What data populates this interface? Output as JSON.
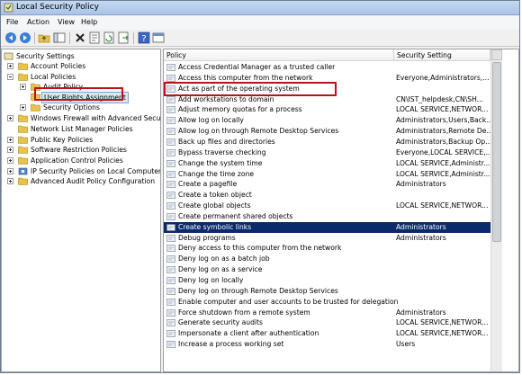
{
  "window": {
    "title": "Local Security Policy"
  },
  "menu": [
    {
      "label": "File"
    },
    {
      "label": "Action"
    },
    {
      "label": "View"
    },
    {
      "label": "Help"
    }
  ],
  "toolbar": {
    "buttons": [
      {
        "icon": "back-arrow-icon"
      },
      {
        "icon": "forward-arrow-icon"
      },
      {
        "icon": "up-folder-icon"
      },
      {
        "icon": "show-hide-tree-icon"
      },
      {
        "icon": "delete-icon"
      },
      {
        "icon": "properties-icon"
      },
      {
        "icon": "refresh-icon"
      },
      {
        "icon": "export-list-icon"
      },
      {
        "icon": "help-icon"
      },
      {
        "icon": "mmc-console-icon"
      }
    ]
  },
  "tree": {
    "items": [
      {
        "label": "Security Settings"
      },
      {
        "label": "Account Policies"
      },
      {
        "label": "Local Policies"
      },
      {
        "label": "Audit Policy"
      },
      {
        "label": "User Rights Assignment"
      },
      {
        "label": "Security Options"
      },
      {
        "label": "Windows Firewall with Advanced Security"
      },
      {
        "label": "Network List Manager Policies"
      },
      {
        "label": "Public Key Policies"
      },
      {
        "label": "Software Restriction Policies"
      },
      {
        "label": "Application Control Policies"
      },
      {
        "label": "IP Security Policies on Local Computer"
      },
      {
        "label": "Advanced Audit Policy Configuration"
      }
    ]
  },
  "list": {
    "columns": [
      {
        "label": "Policy"
      },
      {
        "label": "Security Setting"
      }
    ],
    "rows": [
      {
        "policy": "Access Credential Manager as a trusted caller",
        "setting": ""
      },
      {
        "policy": "Access this computer from the network",
        "setting": "Everyone,Administrators,..."
      },
      {
        "policy": "Act as part of the operating system",
        "setting": ""
      },
      {
        "policy": "Add workstations to domain",
        "setting": "CN\\IST_helpdesk,CN\\SH..."
      },
      {
        "policy": "Adjust memory quotas for a process",
        "setting": "LOCAL SERVICE,NETWOR..."
      },
      {
        "policy": "Allow log on locally",
        "setting": "Administrators,Users,Back..."
      },
      {
        "policy": "Allow log on through Remote Desktop Services",
        "setting": "Administrators,Remote De..."
      },
      {
        "policy": "Back up files and directories",
        "setting": "Administrators,Backup Op..."
      },
      {
        "policy": "Bypass traverse checking",
        "setting": "Everyone,LOCAL SERVICE,..."
      },
      {
        "policy": "Change the system time",
        "setting": "LOCAL SERVICE,Administr..."
      },
      {
        "policy": "Change the time zone",
        "setting": "LOCAL SERVICE,Administr..."
      },
      {
        "policy": "Create a pagefile",
        "setting": "Administrators"
      },
      {
        "policy": "Create a token object",
        "setting": ""
      },
      {
        "policy": "Create global objects",
        "setting": "LOCAL SERVICE,NETWOR..."
      },
      {
        "policy": "Create permanent shared objects",
        "setting": ""
      },
      {
        "policy": "Create symbolic links",
        "setting": "Administrators"
      },
      {
        "policy": "Debug programs",
        "setting": "Administrators"
      },
      {
        "policy": "Deny access to this computer from the network",
        "setting": ""
      },
      {
        "policy": "Deny log on as a batch job",
        "setting": ""
      },
      {
        "policy": "Deny log on as a service",
        "setting": ""
      },
      {
        "policy": "Deny log on locally",
        "setting": ""
      },
      {
        "policy": "Deny log on through Remote Desktop Services",
        "setting": ""
      },
      {
        "policy": "Enable computer and user accounts to be trusted for delegation",
        "setting": ""
      },
      {
        "policy": "Force shutdown from a remote system",
        "setting": "Administrators"
      },
      {
        "policy": "Generate security audits",
        "setting": "LOCAL SERVICE,NETWOR..."
      },
      {
        "policy": "Impersonate a client after authentication",
        "setting": "LOCAL SERVICE,NETWOR..."
      },
      {
        "policy": "Increase a process working set",
        "setting": "Users"
      }
    ],
    "selected_policy": "Create symbolic links"
  },
  "colors": {
    "selection": "#0a2a6a",
    "highlight_box": "#c0111a",
    "folder": "#e8c24a"
  }
}
